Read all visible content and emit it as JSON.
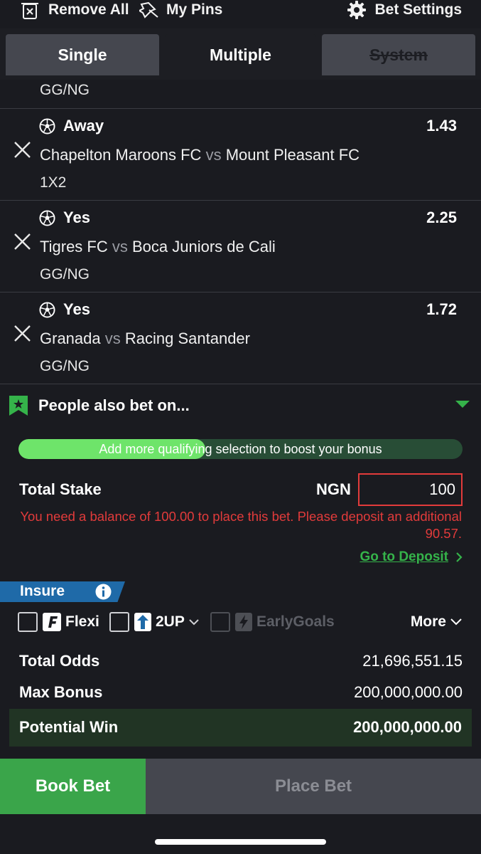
{
  "topbar": {
    "remove_all": "Remove All",
    "my_pins": "My Pins",
    "bet_settings": "Bet Settings"
  },
  "tabs": [
    {
      "label": "Single",
      "active": false
    },
    {
      "label": "Multiple",
      "active": true
    },
    {
      "label": "System",
      "disabled": true
    }
  ],
  "partial_market": "GG/NG",
  "selections": [
    {
      "pick": "Away",
      "odds": "1.43",
      "home": "Chapelton Maroons FC",
      "vs": "vs",
      "away": "Mount Pleasant FC",
      "market": "1X2"
    },
    {
      "pick": "Yes",
      "odds": "2.25",
      "home": "Tigres FC",
      "vs": "vs",
      "away": "Boca Juniors de Cali",
      "market": "GG/NG"
    },
    {
      "pick": "Yes",
      "odds": "1.72",
      "home": "Granada",
      "vs": "vs",
      "away": "Racing Santander",
      "market": "GG/NG"
    }
  ],
  "people_also_bet": "People also bet on...",
  "bonus_progress": {
    "message": "Add more qualifying selection to boost your bonus",
    "fraction": 0.42
  },
  "stake": {
    "label": "Total Stake",
    "currency": "NGN",
    "value": "100"
  },
  "warning": "You need a balance of 100.00 to place this bet. Please deposit an additional 90.57.",
  "deposit_link": "Go to Deposit",
  "insure": {
    "label": "Insure"
  },
  "options": {
    "flexi": "Flexi",
    "twoup": "2UP",
    "early_goals": "EarlyGoals",
    "more": "More"
  },
  "totals": {
    "odds_label": "Total Odds",
    "odds_value": "21,696,551.15",
    "bonus_label": "Max Bonus",
    "bonus_value": "200,000,000.00",
    "win_label": "Potential Win",
    "win_value": "200,000,000.00"
  },
  "buttons": {
    "book_bet": "Book Bet",
    "place_bet": "Place Bet"
  },
  "colors": {
    "accent_green": "#35b34a",
    "error_red": "#e23b3b",
    "insure_blue": "#1f6aa8",
    "background": "#1a1b20"
  }
}
